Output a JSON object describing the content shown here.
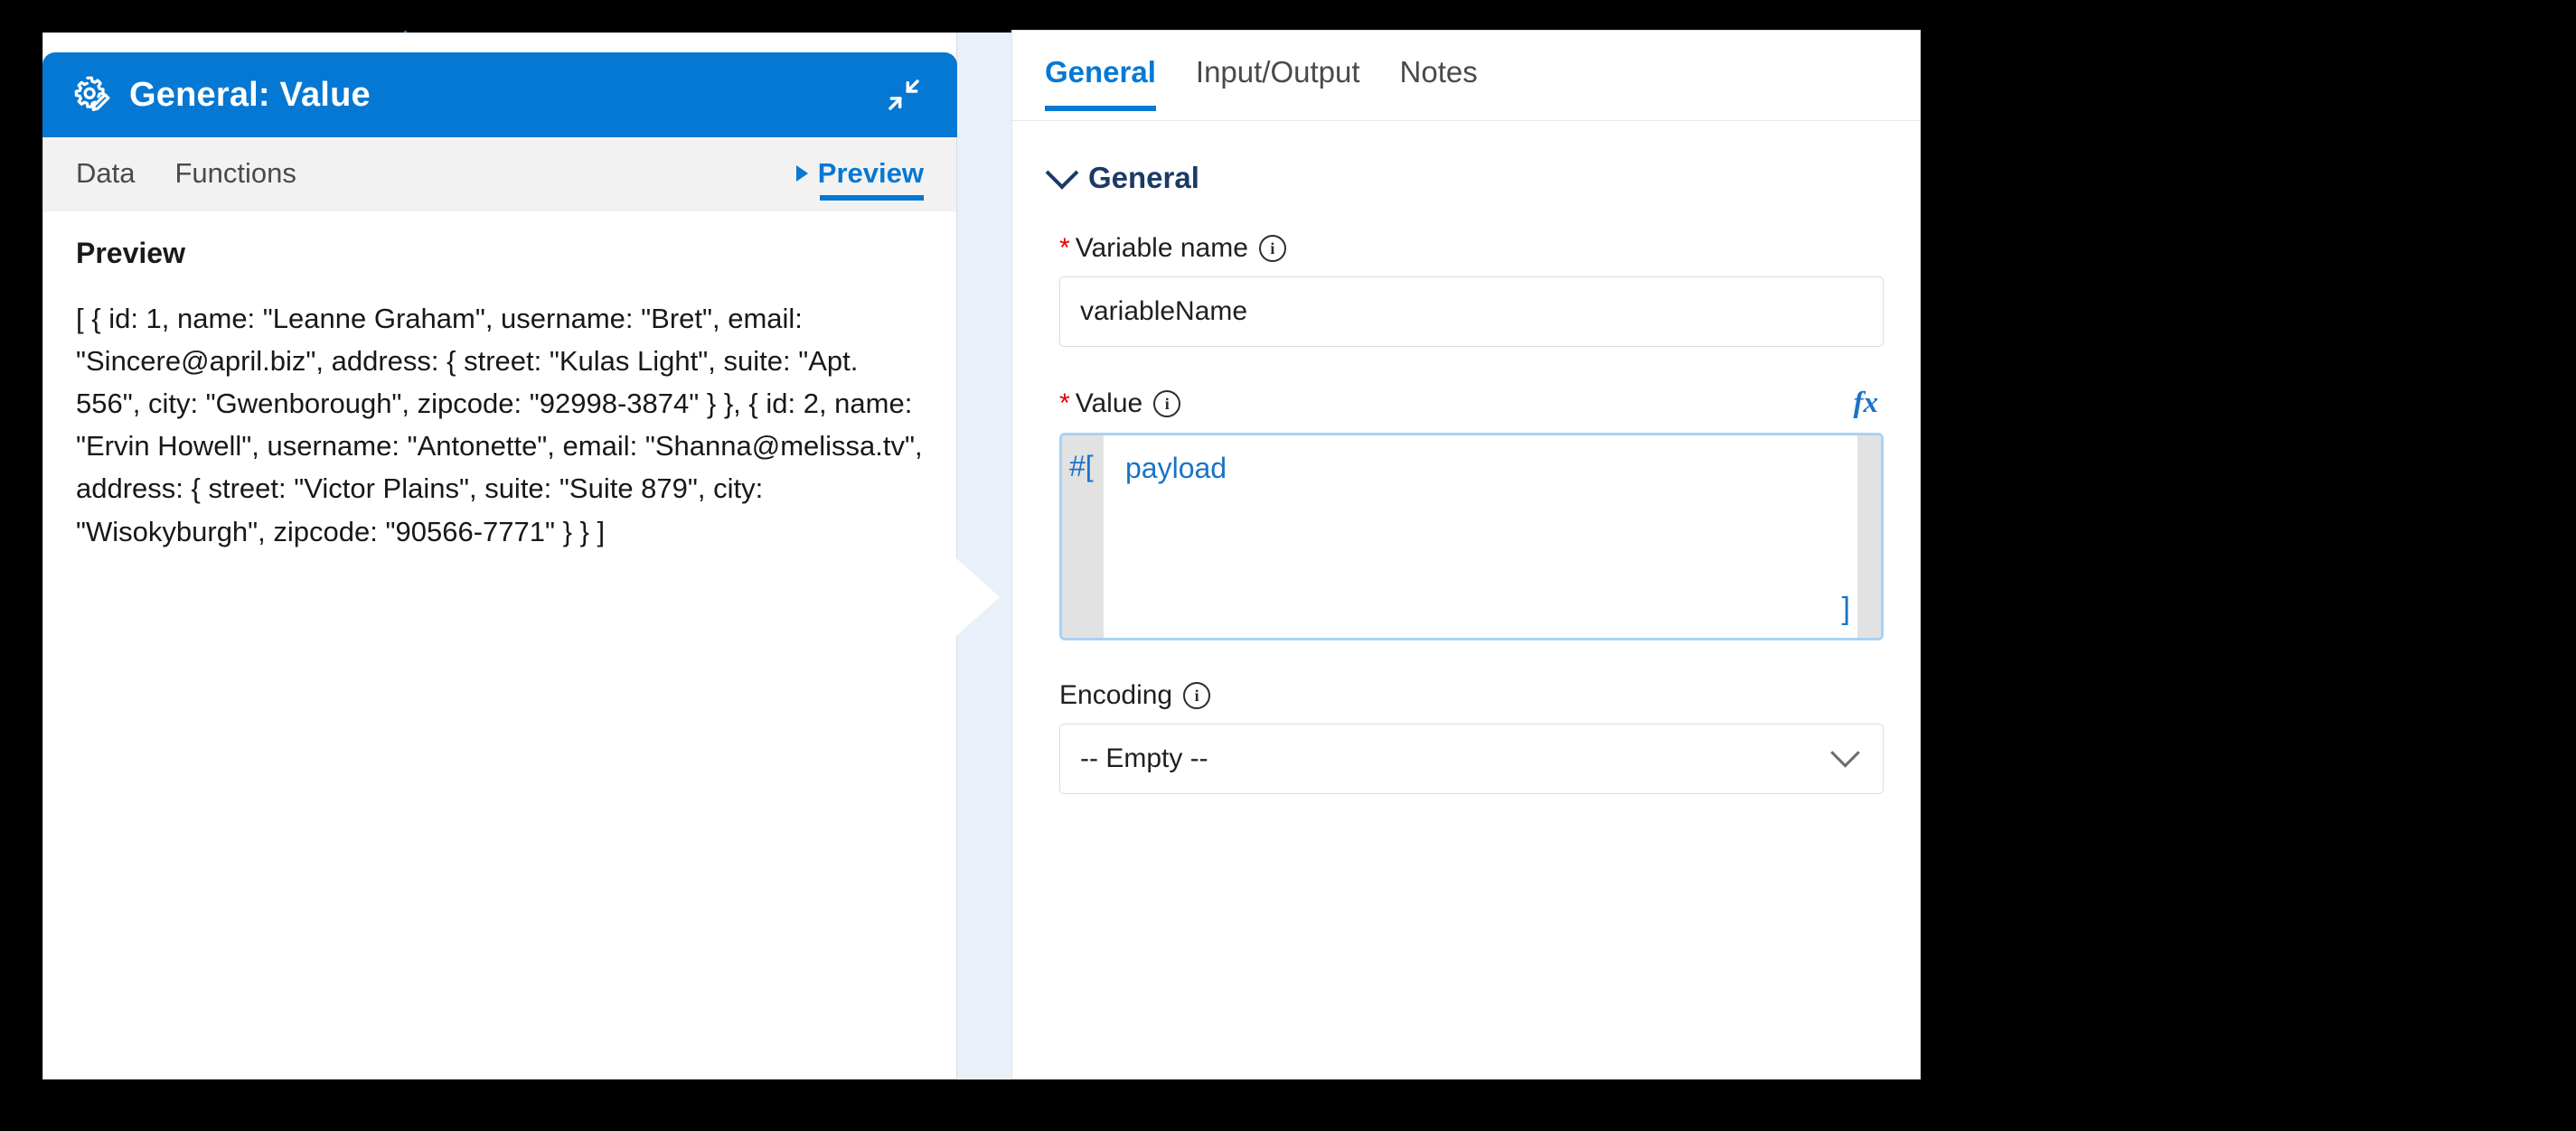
{
  "dsl_panel": {
    "header": {
      "icon": "gear-pencil-icon",
      "title": "General: Value",
      "collapse_icon": "collapse-diagonal-icon"
    },
    "tabs": [
      {
        "label": "Data",
        "active": false
      },
      {
        "label": "Functions",
        "active": false
      },
      {
        "label": "Preview",
        "active": true,
        "icon": "play-triangle-icon"
      }
    ],
    "preview": {
      "heading": "Preview",
      "content": "[ { id: 1, name: \"Leanne Graham\", username: \"Bret\", email: \"Sincere@april.biz\", address: { street: \"Kulas Light\", suite: \"Apt. 556\", city: \"Gwenborough\", zipcode: \"92998-3874\" } }, { id: 2, name: \"Ervin Howell\", username: \"Antonette\", email: \"Shanna@melissa.tv\", address: { street: \"Victor Plains\", suite: \"Suite 879\", city: \"Wisokyburgh\", zipcode: \"90566-7771\" } } ]"
    }
  },
  "properties_panel": {
    "tabs": [
      {
        "label": "General",
        "active": true
      },
      {
        "label": "Input/Output",
        "active": false
      },
      {
        "label": "Notes",
        "active": false
      }
    ],
    "section": {
      "title": "General",
      "chevron_icon": "chevron-down-icon"
    },
    "fields": {
      "variable_name": {
        "label": "Variable name",
        "required_marker": "*",
        "info_icon": "info-icon",
        "value": "variableName",
        "placeholder": ""
      },
      "value": {
        "label": "Value",
        "required_marker": "*",
        "info_icon": "info-icon",
        "fx_label": "fx",
        "open_token": "#[",
        "expression": "payload",
        "close_token": "]"
      },
      "encoding": {
        "label": "Encoding",
        "info_icon": "info-icon",
        "selected": "-- Empty --",
        "chevron_icon": "chevron-down-icon"
      }
    }
  },
  "colors": {
    "accent_blue": "#0578d3",
    "link_blue": "#1a73c7",
    "required_red": "#e60000",
    "editor_border": "#a9d2f3",
    "gutter_gray": "#e2e2e2",
    "gap_strip": "#eaf0fa",
    "tab_strip_gray": "#f2f2f2",
    "section_title": "#1b3a66"
  }
}
